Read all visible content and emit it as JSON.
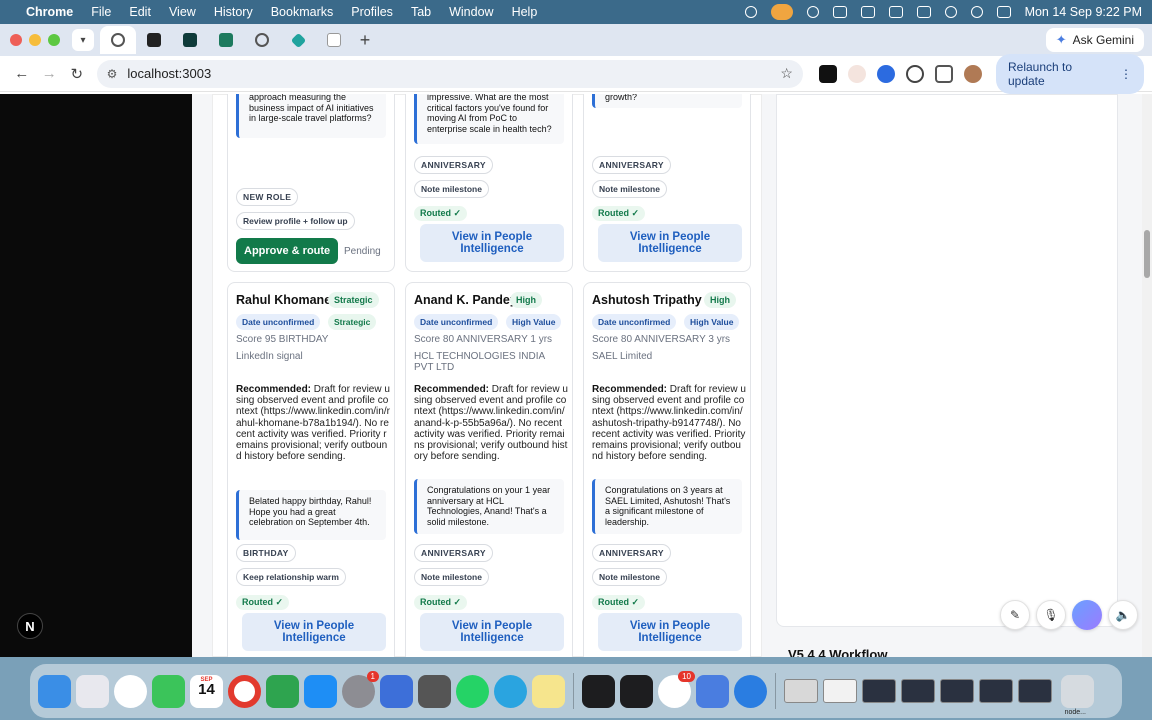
{
  "menubar": {
    "app": "Chrome",
    "items": [
      "File",
      "Edit",
      "View",
      "History",
      "Bookmarks",
      "Profiles",
      "Tab",
      "Window",
      "Help"
    ],
    "clock": "Mon 14 Sep  9:22 PM"
  },
  "browser": {
    "ask_gemini": "Ask Gemini",
    "url": "localhost:3003",
    "relaunch": "Relaunch to update"
  },
  "top_cards": [
    {
      "quote_tail": "approach measuring the business impact of AI initiatives in large-scale travel platforms?",
      "tag": "NEW ROLE",
      "action": "Review profile + follow up",
      "approve": "Approve & route",
      "status": "Pending"
    },
    {
      "quote_tail": "impressive. What are the most critical factors you've found for moving AI from PoC to enterprise scale in health tech?",
      "tag": "ANNIVERSARY",
      "action": "Note milestone",
      "routed": "Routed ✓",
      "view": "View in People Intelligence"
    },
    {
      "quote_tail": "growth?",
      "tag": "ANNIVERSARY",
      "action": "Note milestone",
      "routed": "Routed ✓",
      "view": "View in People Intelligence"
    }
  ],
  "cards": [
    {
      "name": "Rahul Khomane",
      "priority": "Strategic",
      "date_tag": "Date unconfirmed",
      "value_tag": "Strategic",
      "score_line": "Score 95  BIRTHDAY",
      "org": "LinkedIn signal",
      "rec_label": "Recommended:",
      "rec_text": " Draft for review using observed event and profile context (https://www.linkedin.com/in/rahul-khomane-b78a1b194/). No recent activity was verified. Priority remains provisional; verify outbound history before sending.",
      "message": "Belated happy birthday, Rahul! Hope you had a great celebration on September 4th.",
      "tag": "BIRTHDAY",
      "action": "Keep relationship warm",
      "routed": "Routed ✓",
      "view": "View in People Intelligence"
    },
    {
      "name": "Anand K. Pandey",
      "priority": "High",
      "date_tag": "Date unconfirmed",
      "value_tag": "High Value",
      "score_line": "Score 80  ANNIVERSARY  1 yrs",
      "org": "HCL TECHNOLOGIES INDIA PVT LTD",
      "rec_label": "Recommended:",
      "rec_text": " Draft for review using observed event and profile context (https://www.linkedin.com/in/anand-k-p-55b5a96a/). No recent activity was verified. Priority remains provisional; verify outbound history before sending.",
      "message": "Congratulations on your 1 year anniversary at HCL Technologies, Anand! That's a solid milestone.",
      "tag": "ANNIVERSARY",
      "action": "Note milestone",
      "routed": "Routed ✓",
      "view": "View in People Intelligence"
    },
    {
      "name": "Ashutosh Tripathy",
      "priority": "High",
      "date_tag": "Date unconfirmed",
      "value_tag": "High Value",
      "score_line": "Score 80  ANNIVERSARY  3 yrs",
      "org": "SAEL Limited",
      "rec_label": "Recommended:",
      "rec_text": " Draft for review using observed event and profile context (https://www.linkedin.com/in/ashutosh-tripathy-b9147748/). No recent activity was verified. Priority remains provisional; verify outbound history before sending.",
      "message": "Congratulations on 3 years at SAEL Limited, Ashutosh! That's a significant milestone of leadership.",
      "tag": "ANNIVERSARY",
      "action": "Note milestone",
      "routed": "Routed ✓",
      "view": "View in People Intelligence"
    }
  ],
  "right_panel": {
    "workflow_heading": "V5.4.4 Workflow"
  },
  "dock": {
    "calendar_month": "SEP",
    "calendar_day": "14",
    "settings_badge": "1",
    "chatgpt_badge": "10",
    "trash_label": "node..."
  },
  "colors": {
    "primary_green": "#127a4a",
    "link_blue": "#1f5fbf",
    "accent_blue": "#2d6fd6"
  }
}
